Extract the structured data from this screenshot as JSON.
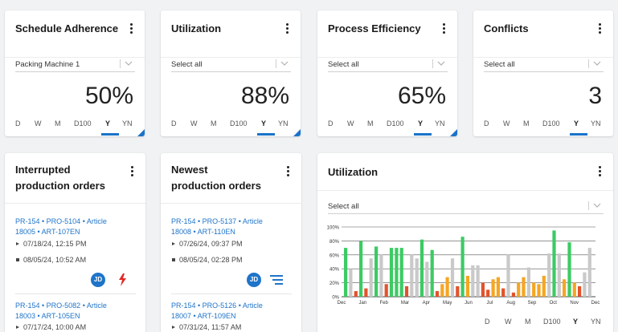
{
  "periods": [
    "D",
    "W",
    "M",
    "D100",
    "Y",
    "YN"
  ],
  "kpis": [
    {
      "title": "Schedule Adherence",
      "select": "Packing Machine 1",
      "value": "50%"
    },
    {
      "title": "Utilization",
      "select": "Select all",
      "value": "88%"
    },
    {
      "title": "Process Efficiency",
      "select": "Select all",
      "value": "65%"
    },
    {
      "title": "Conflicts",
      "select": "Select all",
      "value": "3"
    }
  ],
  "interrupted": {
    "title_line1": "Interrupted",
    "title_line2": "production orders",
    "orders": [
      {
        "link1": "PR-154 • PRO-5104 • Article",
        "link2": "18005 • ART-107EN",
        "start": "07/18/24, 12:15 PM",
        "end": "08/05/24, 10:52 AM",
        "avatar": "JD"
      },
      {
        "link1": "PR-154 • PRO-5082 • Article",
        "link2": "18003 • ART-105EN",
        "start": "07/17/24, 10:00 AM"
      }
    ]
  },
  "newest": {
    "title_line1": "Newest",
    "title_line2": "production orders",
    "orders": [
      {
        "link1": "PR-154 • PRO-5137 • Article",
        "link2": "18008 • ART-110EN",
        "start": "07/26/24, 09:37 PM",
        "end": "08/05/24, 02:28 PM",
        "avatar": "JD"
      },
      {
        "link1": "PR-154 • PRO-5126 • Article",
        "link2": "18007 • ART-109EN",
        "start": "07/31/24, 11:57 AM"
      }
    ]
  },
  "util_chart": {
    "title": "Utilization",
    "select": "Select all",
    "colors": {
      "green": "#3ccb63",
      "gray": "#c9c9c9",
      "orange": "#f5a623",
      "red": "#e2532c"
    }
  },
  "chart_data": {
    "type": "bar",
    "ylim": [
      0,
      100
    ],
    "yticks": [
      "0%",
      "20%",
      "40%",
      "60%",
      "80%",
      "100%"
    ],
    "categories": [
      "Dec",
      "Jan",
      "Feb",
      "Mar",
      "Apr",
      "May",
      "Jun",
      "Jul",
      "Aug",
      "Sep",
      "Oct",
      "Nov",
      "Dec"
    ],
    "bars": [
      {
        "v": 70,
        "c": "green"
      },
      {
        "v": 40,
        "c": "gray"
      },
      {
        "v": 8,
        "c": "red"
      },
      {
        "v": 80,
        "c": "green"
      },
      {
        "v": 12,
        "c": "red"
      },
      {
        "v": 55,
        "c": "gray"
      },
      {
        "v": 72,
        "c": "green"
      },
      {
        "v": 60,
        "c": "gray"
      },
      {
        "v": 18,
        "c": "red"
      },
      {
        "v": 70,
        "c": "green"
      },
      {
        "v": 70,
        "c": "green"
      },
      {
        "v": 70,
        "c": "green"
      },
      {
        "v": 15,
        "c": "red"
      },
      {
        "v": 60,
        "c": "gray"
      },
      {
        "v": 55,
        "c": "gray"
      },
      {
        "v": 82,
        "c": "green"
      },
      {
        "v": 50,
        "c": "gray"
      },
      {
        "v": 67,
        "c": "green"
      },
      {
        "v": 8,
        "c": "red"
      },
      {
        "v": 18,
        "c": "orange"
      },
      {
        "v": 28,
        "c": "orange"
      },
      {
        "v": 55,
        "c": "gray"
      },
      {
        "v": 15,
        "c": "red"
      },
      {
        "v": 86,
        "c": "green"
      },
      {
        "v": 30,
        "c": "orange"
      },
      {
        "v": 45,
        "c": "gray"
      },
      {
        "v": 45,
        "c": "gray"
      },
      {
        "v": 20,
        "c": "red"
      },
      {
        "v": 10,
        "c": "red"
      },
      {
        "v": 25,
        "c": "orange"
      },
      {
        "v": 28,
        "c": "orange"
      },
      {
        "v": 12,
        "c": "red"
      },
      {
        "v": 60,
        "c": "gray"
      },
      {
        "v": 6,
        "c": "red"
      },
      {
        "v": 20,
        "c": "orange"
      },
      {
        "v": 28,
        "c": "orange"
      },
      {
        "v": 42,
        "c": "gray"
      },
      {
        "v": 20,
        "c": "orange"
      },
      {
        "v": 18,
        "c": "orange"
      },
      {
        "v": 30,
        "c": "orange"
      },
      {
        "v": 62,
        "c": "gray"
      },
      {
        "v": 95,
        "c": "green"
      },
      {
        "v": 62,
        "c": "gray"
      },
      {
        "v": 25,
        "c": "orange"
      },
      {
        "v": 78,
        "c": "green"
      },
      {
        "v": 20,
        "c": "orange"
      },
      {
        "v": 15,
        "c": "red"
      },
      {
        "v": 35,
        "c": "gray"
      },
      {
        "v": 70,
        "c": "gray"
      }
    ]
  },
  "chart_periods": [
    "D",
    "W",
    "M",
    "D100",
    "Y",
    "YN"
  ]
}
